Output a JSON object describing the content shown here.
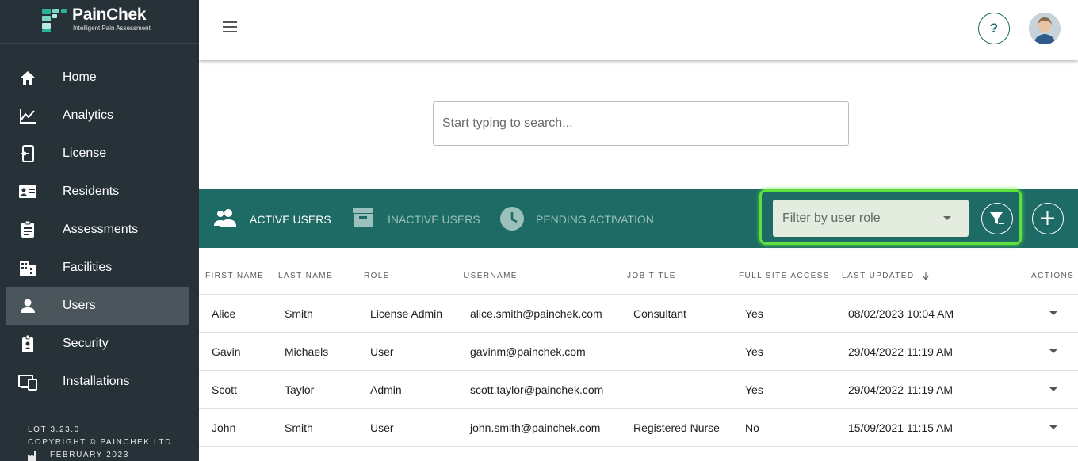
{
  "brand": {
    "name": "PainChek",
    "tagline": "Intelligent Pain Assessment",
    "color": "#1d6b64"
  },
  "sidebar": {
    "items": [
      {
        "label": "Home",
        "icon": "home-icon"
      },
      {
        "label": "Analytics",
        "icon": "chart-line-icon"
      },
      {
        "label": "License",
        "icon": "license-icon"
      },
      {
        "label": "Residents",
        "icon": "id-card-icon"
      },
      {
        "label": "Assessments",
        "icon": "clipboard-icon"
      },
      {
        "label": "Facilities",
        "icon": "building-icon"
      },
      {
        "label": "Users",
        "icon": "person-icon",
        "active": true
      },
      {
        "label": "Security",
        "icon": "security-badge-icon"
      },
      {
        "label": "Installations",
        "icon": "devices-icon"
      }
    ],
    "footer": {
      "version": "LOT 3.23.0",
      "copyright": "COPYRIGHT © PAINCHEK LTD",
      "date": "FEBRUARY 2023"
    }
  },
  "header": {
    "help_label": "?"
  },
  "search": {
    "placeholder": "Start typing to search..."
  },
  "tabs": [
    {
      "label": "ACTIVE USERS",
      "active": true
    },
    {
      "label": "INACTIVE USERS",
      "active": false
    },
    {
      "label": "PENDING ACTIVATION",
      "active": false
    }
  ],
  "filter": {
    "placeholder": "Filter by user role"
  },
  "table": {
    "columns": [
      "FIRST NAME",
      "LAST NAME",
      "ROLE",
      "USERNAME",
      "JOB TITLE",
      "FULL SITE ACCESS",
      "LAST UPDATED",
      "ACTIONS"
    ],
    "rows": [
      {
        "first": "Alice",
        "last": "Smith",
        "role": "License Admin",
        "username": "alice.smith@painchek.com",
        "job": "Consultant",
        "access": "Yes",
        "updated": "08/02/2023 10:04 AM"
      },
      {
        "first": "Gavin",
        "last": "Michaels",
        "role": "User",
        "username": "gavinm@painchek.com",
        "job": "",
        "access": "Yes",
        "updated": "29/04/2022 11:19 AM"
      },
      {
        "first": "Scott",
        "last": "Taylor",
        "role": "Admin",
        "username": "scott.taylor@painchek.com",
        "job": "",
        "access": "Yes",
        "updated": "29/04/2022 11:19 AM"
      },
      {
        "first": "John",
        "last": "Smith",
        "role": "User",
        "username": "john.smith@painchek.com",
        "job": "Registered Nurse",
        "access": "No",
        "updated": "15/09/2021 11:15 AM"
      }
    ]
  }
}
